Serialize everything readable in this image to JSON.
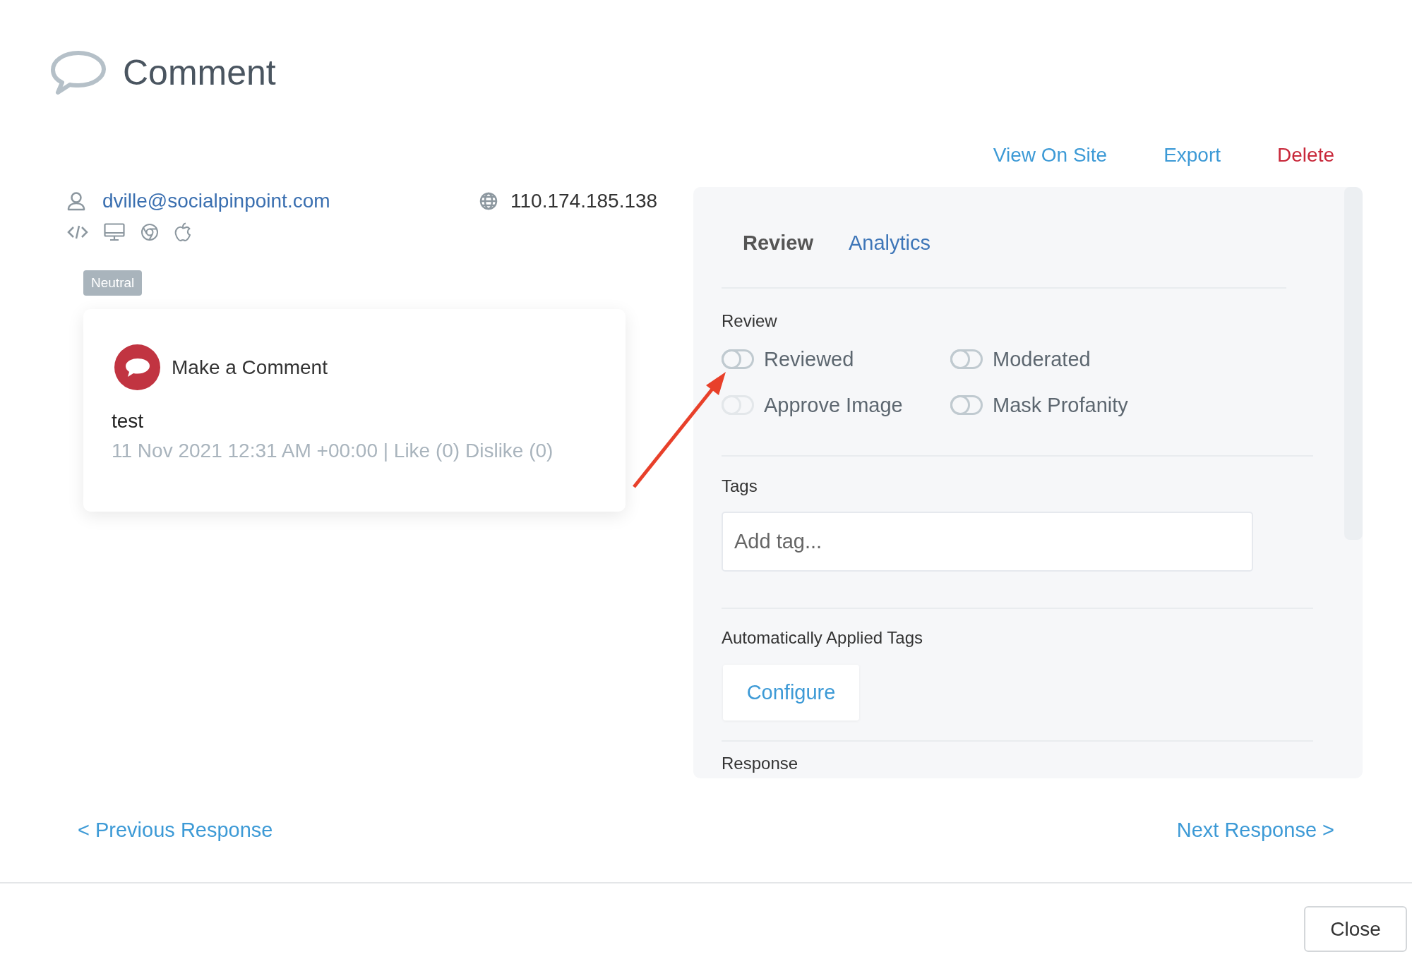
{
  "dialog": {
    "title": "Comment"
  },
  "actions": [
    {
      "label": "View On Site",
      "kind": "link"
    },
    {
      "label": "Export",
      "kind": "link"
    },
    {
      "label": "Delete",
      "kind": "danger"
    }
  ],
  "author": {
    "email": "dville@socialpinpoint.com",
    "ip": "110.174.185.138"
  },
  "sentiment": "Neutral",
  "comment": {
    "type": "Make a Comment",
    "text": "test",
    "meta": "11 Nov 2021 12:31 AM +00:00 | Like (0) Dislike (0)"
  },
  "tabs": [
    {
      "label": "Review",
      "selected": true
    },
    {
      "label": "Analytics",
      "selected": false
    }
  ],
  "review": {
    "heading": "Review",
    "toggles": [
      {
        "label": "Reviewed",
        "on": false,
        "disabled": false
      },
      {
        "label": "Moderated",
        "on": false,
        "disabled": false
      },
      {
        "label": "Approve Image",
        "on": false,
        "disabled": true
      },
      {
        "label": "Mask Profanity",
        "on": false,
        "disabled": false
      }
    ]
  },
  "tags": {
    "heading": "Tags",
    "placeholder": "Add tag..."
  },
  "auto_tags": {
    "heading": "Automatically Applied Tags",
    "button": "Configure"
  },
  "response": {
    "heading": "Response"
  },
  "navigation": {
    "previous": "< Previous Response",
    "next": "Next Response >"
  },
  "footer": {
    "button": "Close"
  }
}
